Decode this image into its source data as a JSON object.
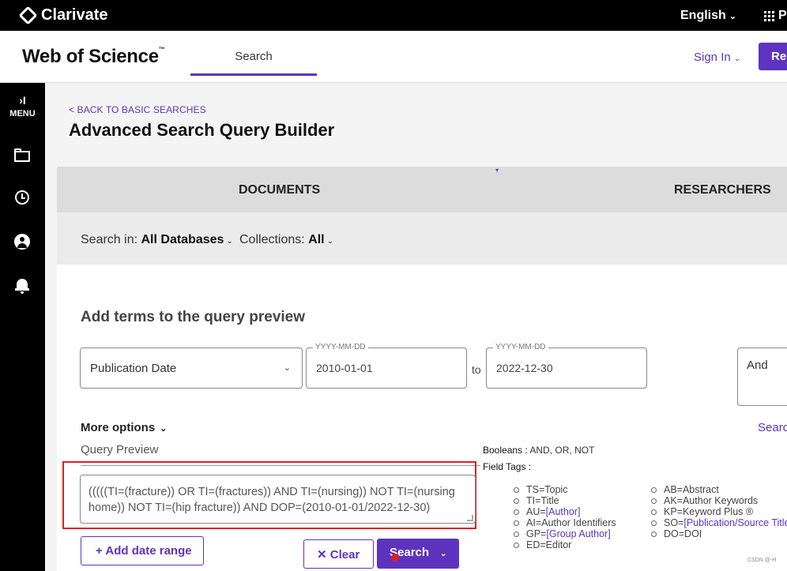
{
  "topbar": {
    "brand": "Clarivate",
    "language": "English",
    "products_label": "P"
  },
  "header": {
    "site_title": "Web of Science",
    "trademark": "™",
    "nav_search": "Search",
    "sign_in": "Sign In",
    "register": "Re"
  },
  "sidemenu": {
    "toggle_icon": "›I",
    "menu_label": "MENU"
  },
  "page": {
    "back_link": "< BACK TO BASIC SEARCHES",
    "title": "Advanced Search Query Builder"
  },
  "tabs": [
    {
      "label": "DOCUMENTS"
    },
    {
      "label": "RESEARCHERS"
    }
  ],
  "search_in": {
    "label": "Search in:",
    "value": "All Databases",
    "collections_label": "Collections:",
    "collections_value": "All"
  },
  "builder": {
    "heading": "Add terms to the query preview",
    "field": "Publication Date",
    "date_placeholder": "YYYY-MM-DD",
    "from_date": "2010-01-01",
    "to_label": "to",
    "to_date": "2022-12-30",
    "operator": "And",
    "more_options": "More options",
    "search_link": "Searc"
  },
  "query_preview": {
    "label": "Query Preview",
    "text": "(((((TI=(fracture)) OR TI=(fractures)) AND TI=(nursing)) NOT TI=(nursing home)) NOT TI=(hip fracture)) AND DOP=(2010-01-01/2022-12-30)"
  },
  "help": {
    "booleans_label": "Booleans :",
    "booleans_value": "AND, OR, NOT",
    "field_tags_label": "Field Tags :",
    "tags_left": [
      {
        "text": "TS=Topic",
        "link": ""
      },
      {
        "text": "TI=Title",
        "link": ""
      },
      {
        "text": "AU=",
        "link": "[Author]"
      },
      {
        "text": "AI=Author Identifiers",
        "link": ""
      },
      {
        "text": "GP=",
        "link": "[Group Author]"
      },
      {
        "text": "ED=Editor",
        "link": ""
      }
    ],
    "tags_right": [
      {
        "text": "AB=Abstract",
        "link": ""
      },
      {
        "text": "AK=Author Keywords",
        "link": ""
      },
      {
        "text": "KP=Keyword Plus ®",
        "link": ""
      },
      {
        "text": "SO=",
        "link": "[Publication/Source Titles]"
      },
      {
        "text": "DO=DOI",
        "link": ""
      }
    ]
  },
  "actions": {
    "add_date_range": "Add date range",
    "clear": "Clear",
    "search": "Search"
  },
  "watermark": "CSDN @-H",
  "colors": {
    "accent": "#5e33bf",
    "highlight": "#e02020",
    "topbar": "#000000"
  }
}
